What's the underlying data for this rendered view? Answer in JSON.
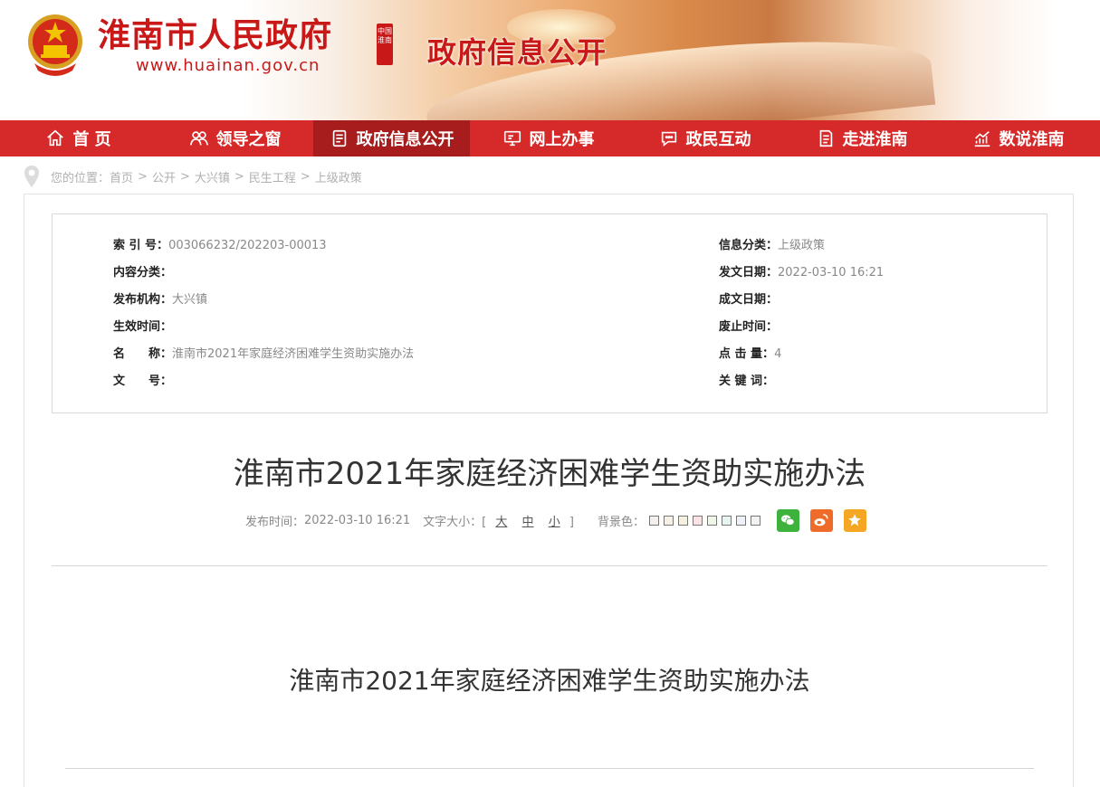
{
  "header": {
    "site_name": "淮南市人民政府",
    "site_url": "www.huainan.gov.cn",
    "seal_text": "中国淮南",
    "section_name": "政府信息公开"
  },
  "nav": {
    "items": [
      {
        "label": "首 页",
        "icon": "home-icon"
      },
      {
        "label": "领导之窗",
        "icon": "people-icon"
      },
      {
        "label": "政府信息公开",
        "icon": "document-icon",
        "active": true
      },
      {
        "label": "网上办事",
        "icon": "monitor-icon"
      },
      {
        "label": "政民互动",
        "icon": "chat-icon"
      },
      {
        "label": "走进淮南",
        "icon": "book-icon"
      },
      {
        "label": "数说淮南",
        "icon": "chart-icon"
      }
    ]
  },
  "breadcrumb": {
    "prefix": "您的位置：",
    "items": [
      "首页",
      "公开",
      "大兴镇",
      "民生工程",
      "上级政策"
    ],
    "separator": ">"
  },
  "meta": {
    "left": [
      {
        "key": "索 引 号：",
        "value": "003066232/202203-00013"
      },
      {
        "key": "内容分类：",
        "value": ""
      },
      {
        "key": "发布机构：",
        "value": "大兴镇"
      },
      {
        "key": "生效时间：",
        "value": ""
      },
      {
        "key": "名　　称：",
        "value": "淮南市2021年家庭经济困难学生资助实施办法"
      },
      {
        "key": "文　　号：",
        "value": ""
      }
    ],
    "right": [
      {
        "key": "信息分类：",
        "value": "上级政策"
      },
      {
        "key": "发文日期：",
        "value": "2022-03-10 16:21"
      },
      {
        "key": "成文日期：",
        "value": ""
      },
      {
        "key": "废止时间：",
        "value": ""
      },
      {
        "key": "点 击 量：",
        "value": "4"
      },
      {
        "key": "关 键 词：",
        "value": ""
      }
    ]
  },
  "article": {
    "title": "淮南市2021年家庭经济困难学生资助实施办法",
    "publish_label": "发布时间：",
    "publish_time": "2022-03-10 16:21",
    "font_size_label": "文字大小：[",
    "font_size_close": "]",
    "font_large": "大",
    "font_medium": "中",
    "font_small": "小",
    "bg_label": "背景色：",
    "bg_colors": [
      "#f6eff0",
      "#f6f0e6",
      "#f4f0e0",
      "#fbe3e3",
      "#f0f7e8",
      "#e6f4ef",
      "#eef1f8",
      "#f2f2f2"
    ],
    "subtitle": "淮南市2021年家庭经济困难学生资助实施办法"
  },
  "share": {
    "wechat_color": "#3db23d",
    "weibo_color": "#ef6b2a",
    "favorite_color": "#f5a623"
  },
  "colors": {
    "brand_red": "#c81818",
    "nav_red": "#d62a2a",
    "nav_active": "#a71d1d"
  }
}
